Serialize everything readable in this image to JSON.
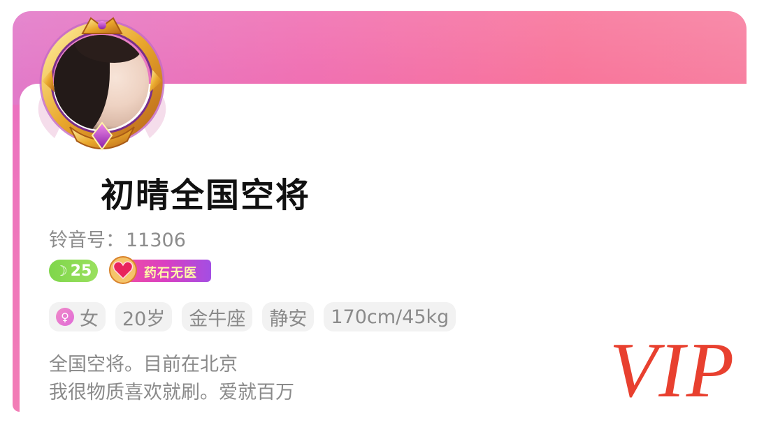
{
  "profile": {
    "username": "初晴全国空将",
    "id_label": "铃音号：",
    "id_value": "11306",
    "level": "25",
    "title_badge": "药石无医",
    "tags": [
      "女",
      "20岁",
      "金牛座",
      "静安",
      "170cm/45kg"
    ],
    "bio": [
      "全国空将。目前在北京",
      "我很物质喜欢就刷。爱就百万"
    ],
    "vip_label": "VIP"
  },
  "colors": {
    "banner_start": "#e27ac9",
    "banner_end": "#f77fa0",
    "level_badge": "#7fd64b",
    "vip": "#e8402f"
  },
  "icons": {
    "level": "moon-icon",
    "gender": "female-icon",
    "title_badge": "heart-icon",
    "frame": "avatar-frame"
  }
}
